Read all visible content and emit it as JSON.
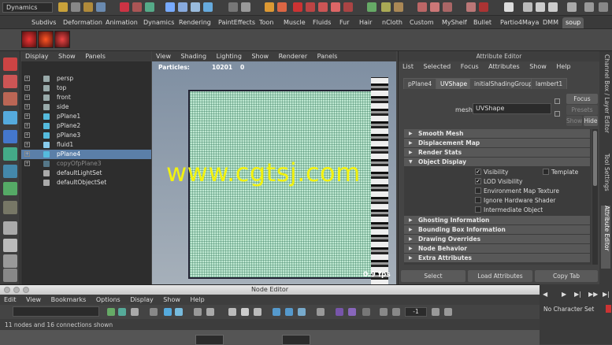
{
  "statusbar": {
    "mode": "Dynamics"
  },
  "shelf_tabs": [
    "Subdivs",
    "Deformation",
    "Animation",
    "Dynamics",
    "Rendering",
    "PaintEffects",
    "Toon",
    "Muscle",
    "Fluids",
    "Fur",
    "Hair",
    "nCloth",
    "Custom",
    "MyShelf",
    "Bullet",
    "Partio4Maya",
    "DMM",
    "soup"
  ],
  "shelf_active": "soup",
  "outliner": {
    "menu": [
      "Display",
      "Show",
      "Panels"
    ],
    "items": [
      {
        "label": "persp",
        "dim": false
      },
      {
        "label": "top",
        "dim": false
      },
      {
        "label": "front",
        "dim": false
      },
      {
        "label": "side",
        "dim": false
      },
      {
        "label": "pPlane1",
        "dim": false
      },
      {
        "label": "pPlane2",
        "dim": false
      },
      {
        "label": "pPlane3",
        "dim": false
      },
      {
        "label": "fluid1",
        "dim": false
      },
      {
        "label": "pPlane4",
        "dim": false
      },
      {
        "label": "copyOfpPlane3",
        "dim": true
      },
      {
        "label": "defaultLightSet",
        "dim": false
      },
      {
        "label": "defaultObjectSet",
        "dim": false
      }
    ],
    "selected": "pPlane4"
  },
  "viewport": {
    "menu": [
      "View",
      "Shading",
      "Lighting",
      "Show",
      "Renderer",
      "Panels"
    ],
    "particles_label": "Particles:",
    "particles_count": "10201",
    "particles_extra": "0",
    "fps": "0.9 fps",
    "watermark": "www.cgtsj.com"
  },
  "attribute_editor": {
    "title": "Attribute Editor",
    "menu": [
      "List",
      "Selected",
      "Focus",
      "Attributes",
      "Show",
      "Help"
    ],
    "tabs": [
      "pPlane4",
      "UVShape",
      "initialShadingGroup",
      "lambert1"
    ],
    "active_tab": "UVShape",
    "mesh_label": "mesh:",
    "mesh_value": "UVShape",
    "buttons": {
      "focus": "Focus",
      "presets": "Presets",
      "show": "Show",
      "hide": "Hide"
    },
    "sections": [
      {
        "label": "Smooth Mesh",
        "open": false
      },
      {
        "label": "Displacement Map",
        "open": false
      },
      {
        "label": "Render Stats",
        "open": false
      },
      {
        "label": "Object Display",
        "open": true
      },
      {
        "label": "Ghosting Information",
        "open": false
      },
      {
        "label": "Bounding Box Information",
        "open": false
      },
      {
        "label": "Drawing Overrides",
        "open": false
      },
      {
        "label": "Node Behavior",
        "open": false
      },
      {
        "label": "Extra Attributes",
        "open": false
      }
    ],
    "object_display": {
      "visibility": "Visibility",
      "template": "Template",
      "lod_visibility": "LOD Visibility",
      "env_map": "Environment Map Texture",
      "ignore_hw": "Ignore Hardware Shader",
      "intermediate": "Intermediate Object"
    },
    "bottom_buttons": [
      "Select",
      "Load Attributes",
      "Copy Tab"
    ]
  },
  "right_tabs": [
    "Channel Box / Layer Editor",
    "Tool Settings",
    "Attribute Editor"
  ],
  "node_editor": {
    "title": "Node Editor",
    "menu": [
      "Edit",
      "View",
      "Bookmarks",
      "Options",
      "Display",
      "Show",
      "Help"
    ],
    "status": "11 nodes and 16 connections shown",
    "tool_value": "-1"
  },
  "timeline": {
    "character_set": "No Character Set"
  }
}
